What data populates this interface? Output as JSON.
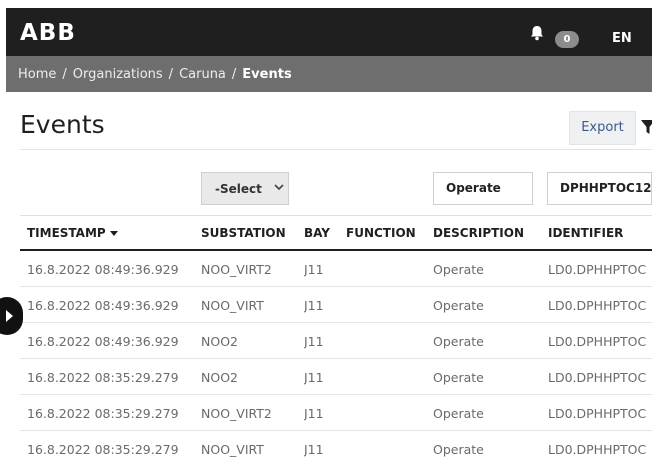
{
  "header": {
    "logo": "ABB",
    "notifications_count": "0",
    "language": "EN"
  },
  "breadcrumb": {
    "items": [
      "Home",
      "Organizations",
      "Caruna"
    ],
    "separator": "/",
    "current": "Events"
  },
  "page": {
    "title": "Events",
    "export_label": "Export"
  },
  "filters": {
    "substation_select": "-Select",
    "description": "Operate",
    "identifier": "DPHHPTOC12"
  },
  "table": {
    "columns": {
      "timestamp": "TIMESTAMP",
      "substation": "SUBSTATION",
      "bay": "BAY",
      "function": "FUNCTION",
      "description": "DESCRIPTION",
      "identifier": "IDENTIFIER"
    },
    "rows": [
      {
        "timestamp": "16.8.2022 08:49:36.929",
        "substation": "NOO_VIRT2",
        "bay": "J11",
        "function": "",
        "description": "Operate",
        "identifier": "LD0.DPHHPTOC"
      },
      {
        "timestamp": "16.8.2022 08:49:36.929",
        "substation": "NOO_VIRT",
        "bay": "J11",
        "function": "",
        "description": "Operate",
        "identifier": "LD0.DPHHPTOC"
      },
      {
        "timestamp": "16.8.2022 08:49:36.929",
        "substation": "NOO2",
        "bay": "J11",
        "function": "",
        "description": "Operate",
        "identifier": "LD0.DPHHPTOC"
      },
      {
        "timestamp": "16.8.2022 08:35:29.279",
        "substation": "NOO2",
        "bay": "J11",
        "function": "",
        "description": "Operate",
        "identifier": "LD0.DPHHPTOC"
      },
      {
        "timestamp": "16.8.2022 08:35:29.279",
        "substation": "NOO_VIRT2",
        "bay": "J11",
        "function": "",
        "description": "Operate",
        "identifier": "LD0.DPHHPTOC"
      },
      {
        "timestamp": "16.8.2022 08:35:29.279",
        "substation": "NOO_VIRT",
        "bay": "J11",
        "function": "",
        "description": "Operate",
        "identifier": "LD0.DPHHPTOC"
      }
    ]
  },
  "icons": {
    "bell": "bell-icon",
    "filter": "filter-icon",
    "chevron": "chevron-down-icon",
    "sort": "sort-desc-icon",
    "side_toggle": "play-arrow-icon"
  },
  "colors": {
    "topbar": "#1f1f1f",
    "breadcrumb_bar": "#6e6e6e",
    "export_text": "#3a5a8c"
  }
}
